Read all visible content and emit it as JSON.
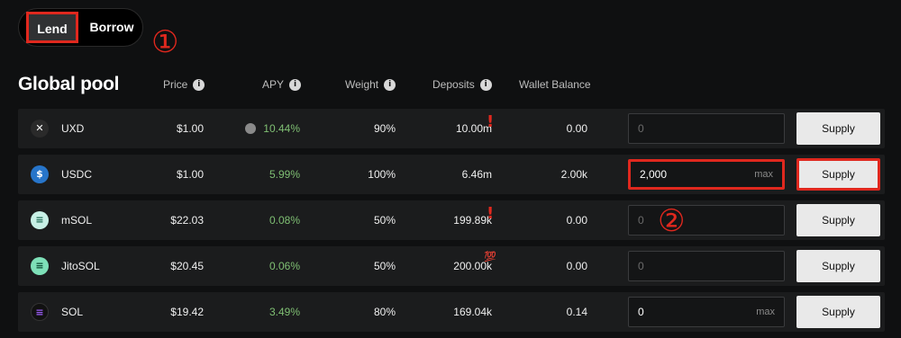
{
  "tabs": {
    "lend": "Lend",
    "borrow": "Borrow"
  },
  "annotations": {
    "one": "①",
    "two": "②"
  },
  "title": "Global pool",
  "headers": {
    "price": "Price",
    "apy": "APY",
    "weight": "Weight",
    "deposits": "Deposits",
    "wallet": "Wallet Balance"
  },
  "rows": [
    {
      "name": "UXD",
      "price": "$1.00",
      "apy": "10.44%",
      "weight": "90%",
      "deposits": "10.00m",
      "wallet": "0.00",
      "amount": "",
      "placeholder": "0",
      "max": "",
      "supply": "Supply",
      "icon": "uxd-icon",
      "mark": "!"
    },
    {
      "name": "USDC",
      "price": "$1.00",
      "apy": "5.99%",
      "weight": "100%",
      "deposits": "6.46m",
      "wallet": "2.00k",
      "amount": "2,000",
      "placeholder": "0",
      "max": "max",
      "supply": "Supply",
      "icon": "usdc-icon",
      "mark": ""
    },
    {
      "name": "mSOL",
      "price": "$22.03",
      "apy": "0.08%",
      "weight": "50%",
      "deposits": "199.89k",
      "wallet": "0.00",
      "amount": "",
      "placeholder": "0",
      "max": "",
      "supply": "Supply",
      "icon": "msol-icon",
      "mark": "!"
    },
    {
      "name": "JitoSOL",
      "price": "$20.45",
      "apy": "0.06%",
      "weight": "50%",
      "deposits": "200.00k",
      "wallet": "0.00",
      "amount": "",
      "placeholder": "0",
      "max": "",
      "supply": "Supply",
      "icon": "jitosol-icon",
      "mark": "💯"
    },
    {
      "name": "SOL",
      "price": "$19.42",
      "apy": "3.49%",
      "weight": "80%",
      "deposits": "169.04k",
      "wallet": "0.14",
      "amount": "0",
      "placeholder": "0",
      "max": "max",
      "supply": "Supply",
      "icon": "sol-icon",
      "mark": ""
    }
  ],
  "colors": {
    "accent_red": "#e0281e",
    "apy_green": "#7fbf73",
    "row_bg": "#1b1c1d"
  }
}
